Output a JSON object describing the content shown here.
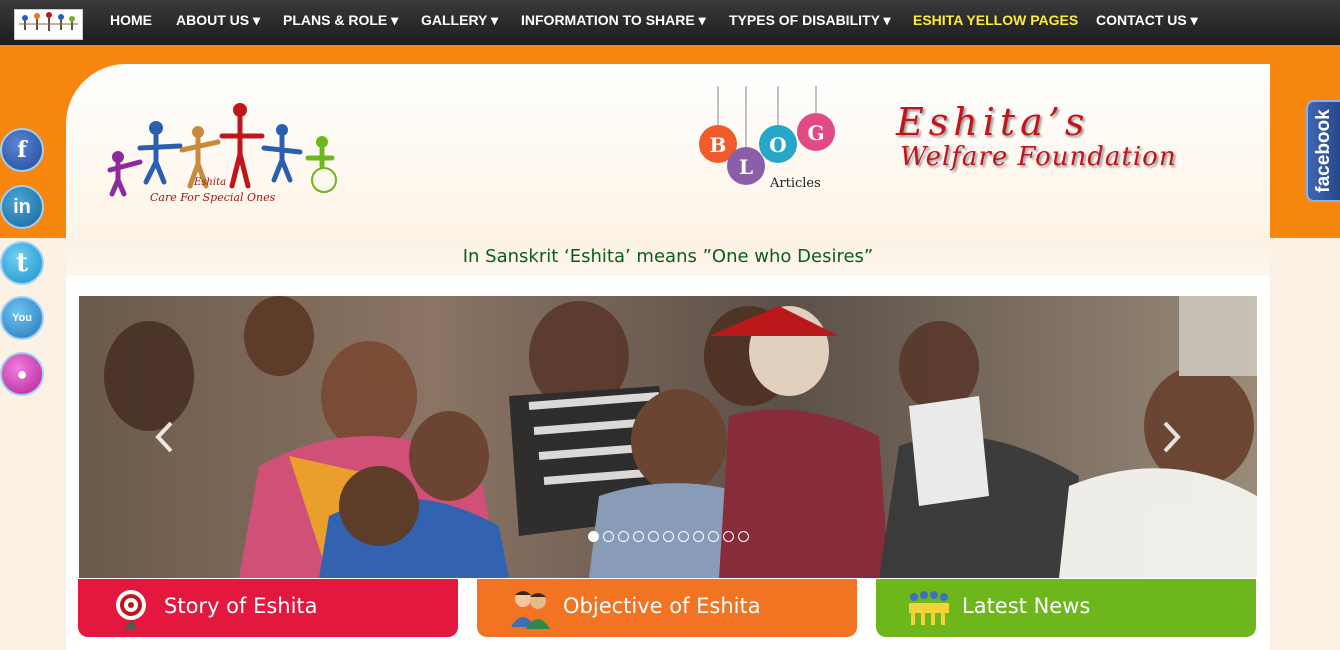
{
  "nav": {
    "logo_alt": "Eshita logo",
    "items": [
      {
        "label": "HOME"
      },
      {
        "label": "ABOUT US ▾"
      },
      {
        "label": "PLANS & ROLE ▾"
      },
      {
        "label": "GALLERY ▾"
      },
      {
        "label": "INFORMATION TO SHARE ▾"
      },
      {
        "label": "TYPES OF DISABILITY ▾"
      },
      {
        "label": "ESHITA YELLOW PAGES"
      },
      {
        "label": "CONTACT US ▾"
      }
    ]
  },
  "header": {
    "brand_name": "Eshita",
    "brand_tagline": "Care For Special Ones",
    "blog_letters": [
      "B",
      "L",
      "O",
      "G"
    ],
    "blog_caption": "Articles",
    "title_line1": "Eshita’s",
    "title_line2": "Welfare Foundation"
  },
  "facebook_tab": {
    "label": "facebook"
  },
  "social": [
    {
      "icon": "facebook-icon",
      "glyph": "f"
    },
    {
      "icon": "linkedin-icon",
      "glyph": "in"
    },
    {
      "icon": "twitter-icon",
      "glyph": "t"
    },
    {
      "icon": "youtube-icon",
      "glyph": "You"
    },
    {
      "icon": "reddit-icon",
      "glyph": "●"
    }
  ],
  "tagline": "In Sanskrit ‘Eshita’ means ”One who Desires”",
  "slider": {
    "dot_count": 11,
    "active_index": 0
  },
  "features": [
    {
      "label": "Story of Eshita",
      "color": "#e4173f"
    },
    {
      "label": "Objective of Eshita",
      "color": "#f27321"
    },
    {
      "label": "Latest News",
      "color": "#6db71c"
    }
  ],
  "colors": {
    "orange": "#f7860f",
    "title_red": "#c0151a",
    "tagline_green": "#0d5c1e"
  }
}
